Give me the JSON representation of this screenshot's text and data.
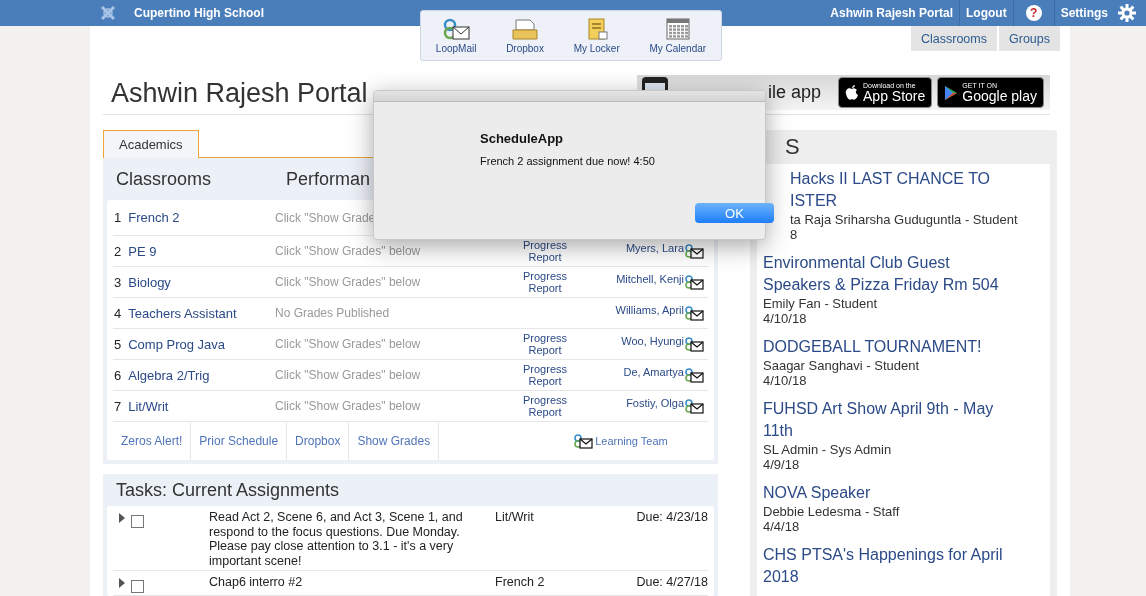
{
  "topbar": {
    "school": "Cupertino High School",
    "portal": "Ashwin Rajesh Portal",
    "logout": "Logout",
    "help": "?",
    "settings": "Settings"
  },
  "toolbar": [
    {
      "label": "LoopMail",
      "kind": "loopmail"
    },
    {
      "label": "Dropbox",
      "kind": "dropbox"
    },
    {
      "label": "My Locker",
      "kind": "locker"
    },
    {
      "label": "My Calendar",
      "kind": "calendar"
    }
  ],
  "nav_tabs": [
    "Classrooms",
    "Groups"
  ],
  "page_title": "Ashwin Rajesh Portal",
  "banner": {
    "text": "ile app",
    "badges": [
      {
        "kind": "apple",
        "small": "Download on the",
        "big": "App Store"
      },
      {
        "kind": "google",
        "small": "GET IT ON",
        "big": "Google play"
      }
    ]
  },
  "tabs": [
    {
      "label": "Academics",
      "selected": true
    }
  ],
  "classrooms": {
    "headings": [
      "Classrooms",
      "Performan"
    ],
    "rows": [
      {
        "num": "1",
        "name": "French 2",
        "performance": "Click \"Show Grade"
      },
      {
        "num": "2",
        "name": "PE 9",
        "performance": "Click \"Show Grades\" below",
        "progress": "Progress Report",
        "teacher": "Myers, Lara"
      },
      {
        "num": "3",
        "name": "Biology",
        "performance": "Click \"Show Grades\" below",
        "progress": "Progress Report",
        "teacher": "Mitchell, Kenji"
      },
      {
        "num": "4",
        "name": "Teachers Assistant",
        "performance": "No Grades Published",
        "teacher": "Williams, April"
      },
      {
        "num": "5",
        "name": "Comp Prog Java",
        "performance": "Click \"Show Grades\" below",
        "progress": "Progress Report",
        "teacher": "Woo, Hyungi"
      },
      {
        "num": "6",
        "name": "Algebra 2/Trig",
        "performance": "Click \"Show Grades\" below",
        "progress": "Progress Report",
        "teacher": "De, Amartya"
      },
      {
        "num": "7",
        "name": "Lit/Writ",
        "performance": "Click \"Show Grades\" below",
        "progress": "Progress Report",
        "teacher": "Fostiy, Olga"
      }
    ],
    "links": [
      "Zeros Alert!",
      "Prior Schedule",
      "Dropbox",
      "Show Grades"
    ],
    "learning_team": "Learning Team"
  },
  "tasks": {
    "title": "Tasks: Current Assignments",
    "rows": [
      {
        "expanded": false,
        "checked": false,
        "text": "Read Act 2, Scene 6, and Act 3, Scene 1, and respond to the focus questions. Due Monday. Please pay close attention to 3.1 - it's a very important scene!",
        "course": "Lit/Writ",
        "due": "Due: 4/23/18"
      },
      {
        "expanded": false,
        "checked": false,
        "text": "Chap6 interro #2",
        "course": "French 2",
        "due": "Due: 4/27/18"
      }
    ]
  },
  "news": {
    "heading": "S",
    "items": [
      {
        "kind": "covered",
        "title_lines": [
          "Hacks II LAST CHANCE TO",
          "ISTER"
        ],
        "author": "ta Raja Sriharsha Guduguntla - Student",
        "date": "8"
      },
      {
        "kind": "full",
        "title_lines": [
          "Environmental Club Guest",
          "Speakers & Pizza Friday Rm 504"
        ],
        "author": "Emily Fan - Student",
        "date": "4/10/18"
      },
      {
        "kind": "full",
        "title_lines": [
          "DODGEBALL TOURNAMENT!"
        ],
        "author": "Saagar Sanghavi - Student",
        "date": "4/10/18"
      },
      {
        "kind": "full",
        "title_lines": [
          "FUHSD Art Show April 9th - May",
          "11th"
        ],
        "author": "SL Admin - Sys Admin",
        "date": "4/9/18"
      },
      {
        "kind": "full",
        "title_lines": [
          "NOVA Speaker"
        ],
        "author": "Debbie Ledesma - Staff",
        "date": "4/4/18"
      },
      {
        "kind": "full",
        "title_lines": [
          "CHS PTSA's Happenings for April",
          "2018"
        ]
      }
    ]
  },
  "dialog": {
    "title": "ScheduleApp",
    "message": "French 2 assignment due now! 4:50",
    "button": "OK"
  }
}
